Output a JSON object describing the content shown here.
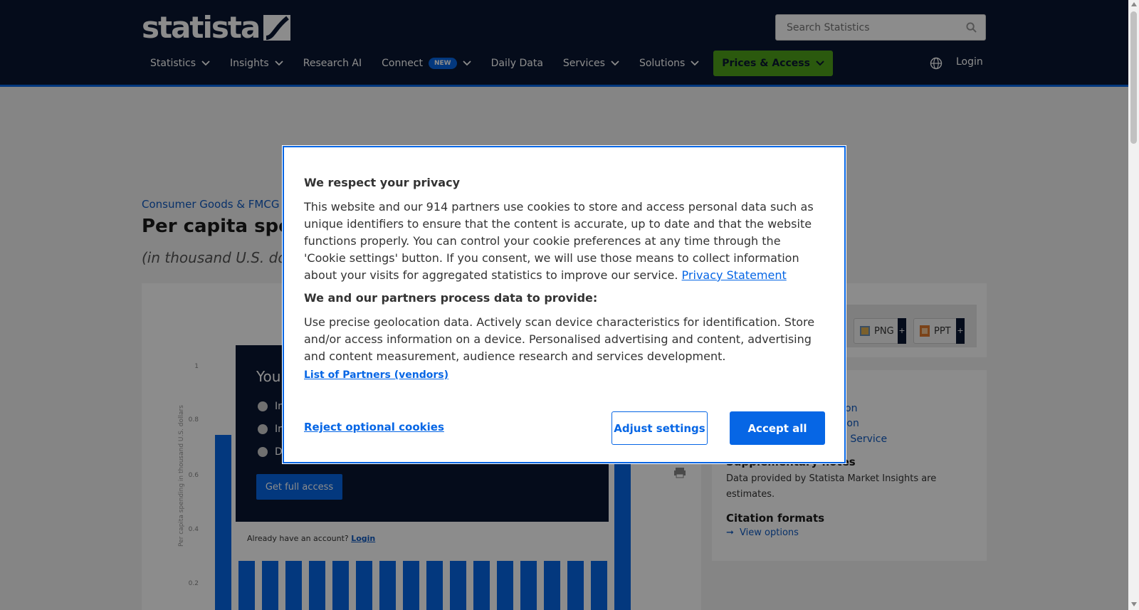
{
  "header": {
    "logo_text": "statista",
    "search_placeholder": "Search Statistics",
    "nav": [
      {
        "label": "Statistics"
      },
      {
        "label": "Insights"
      },
      {
        "label": "Research AI"
      },
      {
        "label": "Connect",
        "badge": "NEW"
      },
      {
        "label": "Daily Data"
      },
      {
        "label": "Services"
      },
      {
        "label": "Solutions"
      },
      {
        "label": "Prices & Access"
      }
    ],
    "login": "Login",
    "colors": {
      "bg": "#0a1732",
      "accent": "#0666e5",
      "prices": "#4fa21a"
    }
  },
  "page": {
    "breadcrumb": "Consumer Goods & FMCG ›",
    "title": "Per capita spen",
    "subtitle": "(in thousand U.S. do",
    "chart": {
      "y_ticks": [
        "1",
        "0.8",
        "0.6",
        "0.4",
        "0.2"
      ],
      "ylabel": "Per capita spending in thousand U.S. dollars"
    },
    "paywall": {
      "title": "You",
      "items": [
        "In",
        "In",
        "D"
      ],
      "cta": "Get full access",
      "already_text": "Already have an account?",
      "login_link": "Login"
    },
    "export": {
      "png": "PNG",
      "ppt": "PPT",
      "plus": "+"
    },
    "info": {
      "links": [
        "on",
        "tion",
        "h Service"
      ],
      "supp_heading": "Supplementary notes",
      "supp_text": "Data provided by Statista Market Insights are estimates.",
      "citation_heading": "Citation formats",
      "citation_link": "View options"
    }
  },
  "cookie_modal": {
    "title": "We respect your privacy",
    "body": "This website and our 914 partners use cookies to store and access personal data such as unique identifiers to ensure that the content is accurate, up to date and that the website functions properly. You can control your cookie preferences at any time through the 'Cookie settings' button. If you consent, we will use those means to collect information about your visits for aggregated statistics to improve our service.",
    "privacy_link": "Privacy Statement",
    "subheading": "We and our partners process data to provide:",
    "purposes": "Use precise geolocation data. Actively scan device characteristics for identification. Store and/or access information on a device. Personalised advertising and content, advertising and content measurement, audience research and services development.",
    "partners_link": "List of Partners (vendors)",
    "reject_label": "Reject optional cookies",
    "adjust_label": "Adjust settings",
    "accept_label": "Accept all"
  }
}
